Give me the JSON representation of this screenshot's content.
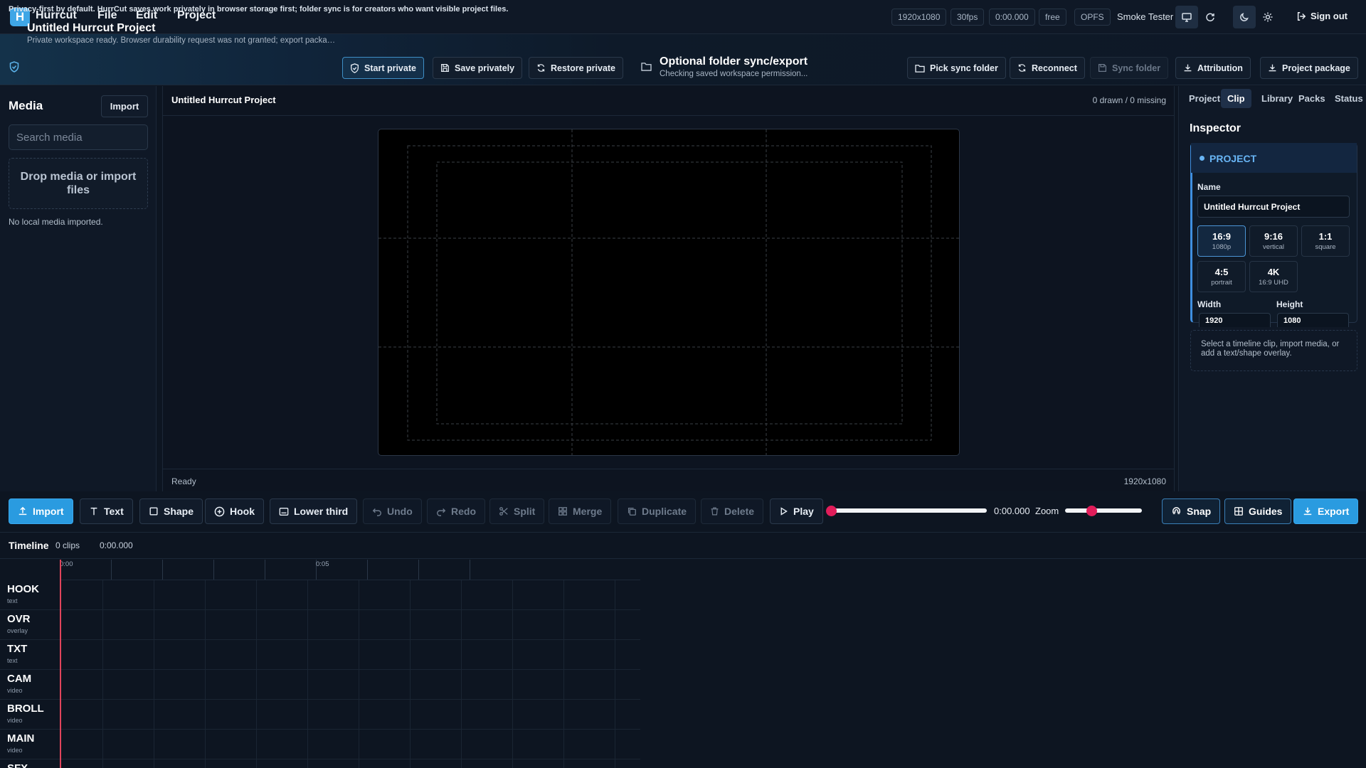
{
  "app": {
    "logo_letter": "H",
    "name": "Hurrcut",
    "menu": [
      "File",
      "Edit",
      "Project"
    ],
    "chips": [
      "1920x1080",
      "30fps",
      "0:00.000",
      "free",
      "OPFS"
    ],
    "user": "Smoke Tester",
    "sign_out": "Sign out",
    "icons": [
      "monitor-icon",
      "refresh-icon",
      "moon-icon",
      "sun-icon"
    ]
  },
  "banner": {
    "note": "Privacy-first by default. HurrCut saves work privately in browser storage first; folder sync is for creators who want visible project files.",
    "project_title": "Untitled Hurrcut Project",
    "project_sub": "Private workspace ready. Browser durability request was not granted; export package or pick a sync folder for backup.",
    "start_private": "Start private",
    "save_privately": "Save privately",
    "restore_private": "Restore private",
    "sync_title": "Optional folder sync/export",
    "sync_sub": "Checking saved workspace permission...",
    "pick_sync_folder": "Pick sync folder",
    "reconnect": "Reconnect",
    "sync_folder": "Sync folder",
    "attribution": "Attribution",
    "project_package": "Project package"
  },
  "media": {
    "title": "Media",
    "import": "Import",
    "search_placeholder": "Search media",
    "dropzone": "Drop media or import files",
    "empty": "No local media imported."
  },
  "stage": {
    "title": "Untitled Hurrcut Project",
    "count": "0 drawn / 0 missing",
    "status": "Ready",
    "resolution": "1920x1080"
  },
  "inspector": {
    "tabs": [
      "Project",
      "Clip",
      "Library",
      "Packs",
      "Status"
    ],
    "active_tab": "Clip",
    "title": "Inspector",
    "card_label": "PROJECT",
    "name_label": "Name",
    "name_value": "Untitled Hurrcut Project",
    "presets": [
      {
        "main": "16:9",
        "sub": "1080p",
        "active": true
      },
      {
        "main": "9:16",
        "sub": "vertical",
        "active": false
      },
      {
        "main": "1:1",
        "sub": "square",
        "active": false
      },
      {
        "main": "4:5",
        "sub": "portrait",
        "active": false
      },
      {
        "main": "4K",
        "sub": "16:9 UHD",
        "active": false
      }
    ],
    "width_label": "Width",
    "height_label": "Height",
    "width_value": "1920",
    "height_value": "1080",
    "help": "Select a timeline clip, import media, or add a text/shape overlay."
  },
  "toolbar": {
    "import": "Import",
    "text": "Text",
    "shape": "Shape",
    "hook": "Hook",
    "lower_third": "Lower third",
    "undo": "Undo",
    "redo": "Redo",
    "split": "Split",
    "merge": "Merge",
    "duplicate": "Duplicate",
    "delete": "Delete",
    "play": "Play",
    "timecode": "0:00.000",
    "zoom_label": "Zoom",
    "playback_position": 0,
    "zoom_level": 0.32,
    "snap": "Snap",
    "guides": "Guides",
    "export": "Export"
  },
  "timeline": {
    "title": "Timeline",
    "clips": "0 clips",
    "time": "0:00.000",
    "ruler_labels": [
      "0:00",
      "0:05"
    ],
    "tracks": [
      {
        "name": "HOOK",
        "type": "text"
      },
      {
        "name": "OVR",
        "type": "overlay"
      },
      {
        "name": "TXT",
        "type": "text"
      },
      {
        "name": "CAM",
        "type": "video"
      },
      {
        "name": "BROLL",
        "type": "video"
      },
      {
        "name": "MAIN",
        "type": "video"
      },
      {
        "name": "SFX",
        "type": ""
      }
    ]
  }
}
